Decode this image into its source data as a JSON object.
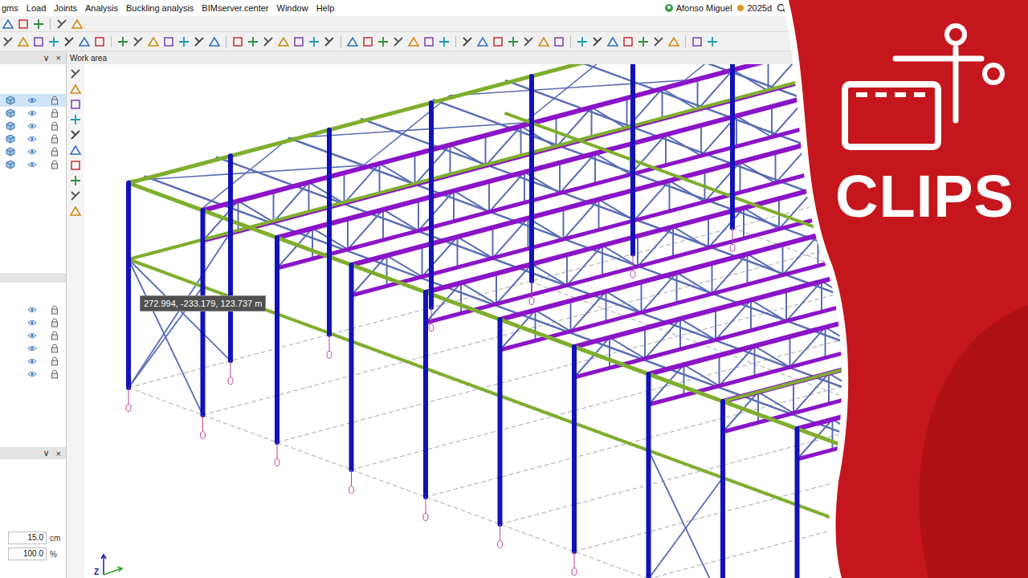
{
  "menu": [
    {
      "label": "gms"
    },
    {
      "label": "Load"
    },
    {
      "label": "Joints"
    },
    {
      "label": "Analysis"
    },
    {
      "label": "Buckling analysis"
    },
    {
      "label": "BIMserver.center"
    },
    {
      "label": "Window"
    },
    {
      "label": "Help"
    }
  ],
  "account": {
    "user": "Afonso Miguel",
    "version": "2025d"
  },
  "work_area": {
    "title": "Work area",
    "tooltip": "272.994, -233.179, 123.737 m",
    "axis": "Z"
  },
  "panels": [
    {
      "kind": "models",
      "collapse": "∨",
      "close": "×",
      "rows": [
        {
          "selected": true
        },
        {
          "selected": false
        },
        {
          "selected": false
        },
        {
          "selected": false
        },
        {
          "selected": false
        },
        {
          "selected": false
        }
      ]
    },
    {
      "kind": "groups",
      "rows": [
        {
          "selected": false
        },
        {
          "selected": false
        },
        {
          "selected": false
        },
        {
          "selected": false
        },
        {
          "selected": false
        },
        {
          "selected": false
        }
      ]
    },
    {
      "kind": "settings",
      "collapse": "∨",
      "close": "×",
      "fields": [
        {
          "value": "15.0",
          "unit": "cm"
        },
        {
          "value": "100.0",
          "unit": "%"
        }
      ]
    }
  ],
  "banner": {
    "label": "CLIPS"
  }
}
